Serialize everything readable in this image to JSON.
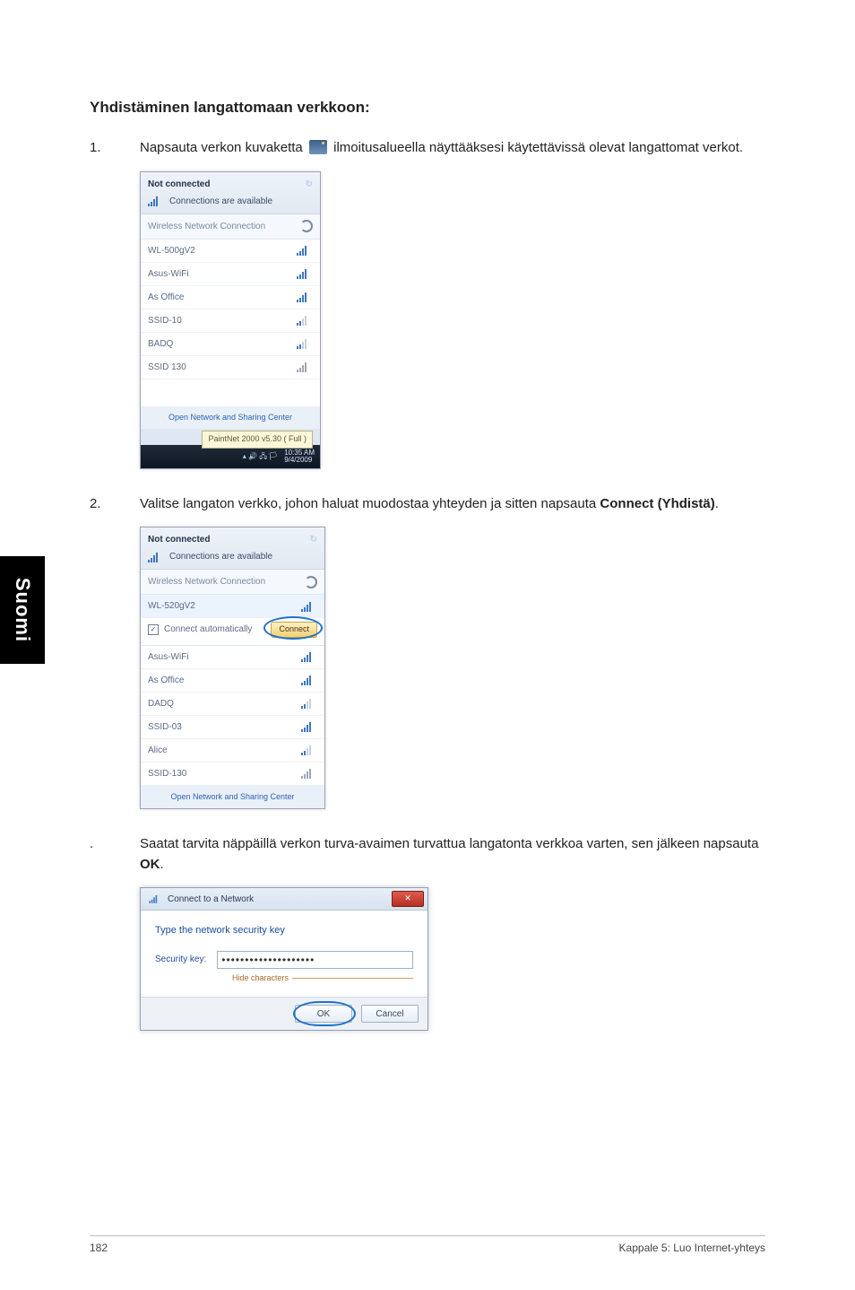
{
  "side_tab": "Suomi",
  "title": "Yhdistäminen langattomaan verkkoon:",
  "steps": [
    {
      "num": "1.",
      "before_icon": "Napsauta verkon kuvaketta ",
      "after_icon": " ilmoitusalueella näyttääksesi käytettävissä olevat langattomat verkot."
    },
    {
      "num": "2.",
      "text_a": "Valitse langaton verkko, johon haluat muodostaa yhteyden ja sitten napsauta ",
      "bold_a": "Connect (Yhdistä)",
      "text_b": "."
    },
    {
      "num": ".",
      "text_a": "Saatat tarvita näppäillä verkon turva-avaimen turvattua langatonta verkkoa varten, sen jälkeen napsauta ",
      "bold_a": "OK",
      "text_b": "."
    }
  ],
  "shot1": {
    "not_connected": "Not connected",
    "avail": "Connections are available",
    "section": "Wireless Network Connection",
    "nets": [
      "WL-500gV2",
      "Asus-WiFi",
      "As Office",
      "SSID-10",
      "BADQ",
      "SSID 130"
    ],
    "foot": "Open Network and Sharing Center",
    "tooltip": "PaintNet 2000 v5.30 ( Full )",
    "time1": "10:35 AM",
    "time2": "9/4/2009"
  },
  "shot2": {
    "not_connected": "Not connected",
    "avail": "Connections are available",
    "section": "Wireless Network Connection",
    "selected": "WL-520gV2",
    "auto_label": "Connect automatically",
    "auto_checked": "✓",
    "connect": "Connect",
    "nets": [
      "Asus-WiFi",
      "As Office",
      "DADQ",
      "SSID-03",
      "Alice",
      "SSID-130"
    ],
    "foot": "Open Network and Sharing Center"
  },
  "shot3": {
    "title": "Connect to a Network",
    "close": "✕",
    "prompt": "Type the network security key",
    "label": "Security key:",
    "value": "••••••••••••••••••••",
    "hide": "Hide characters",
    "ok": "OK",
    "cancel": "Cancel"
  },
  "footer": {
    "page": "182",
    "chapter": "Kappale 5: Luo Internet-yhteys"
  }
}
